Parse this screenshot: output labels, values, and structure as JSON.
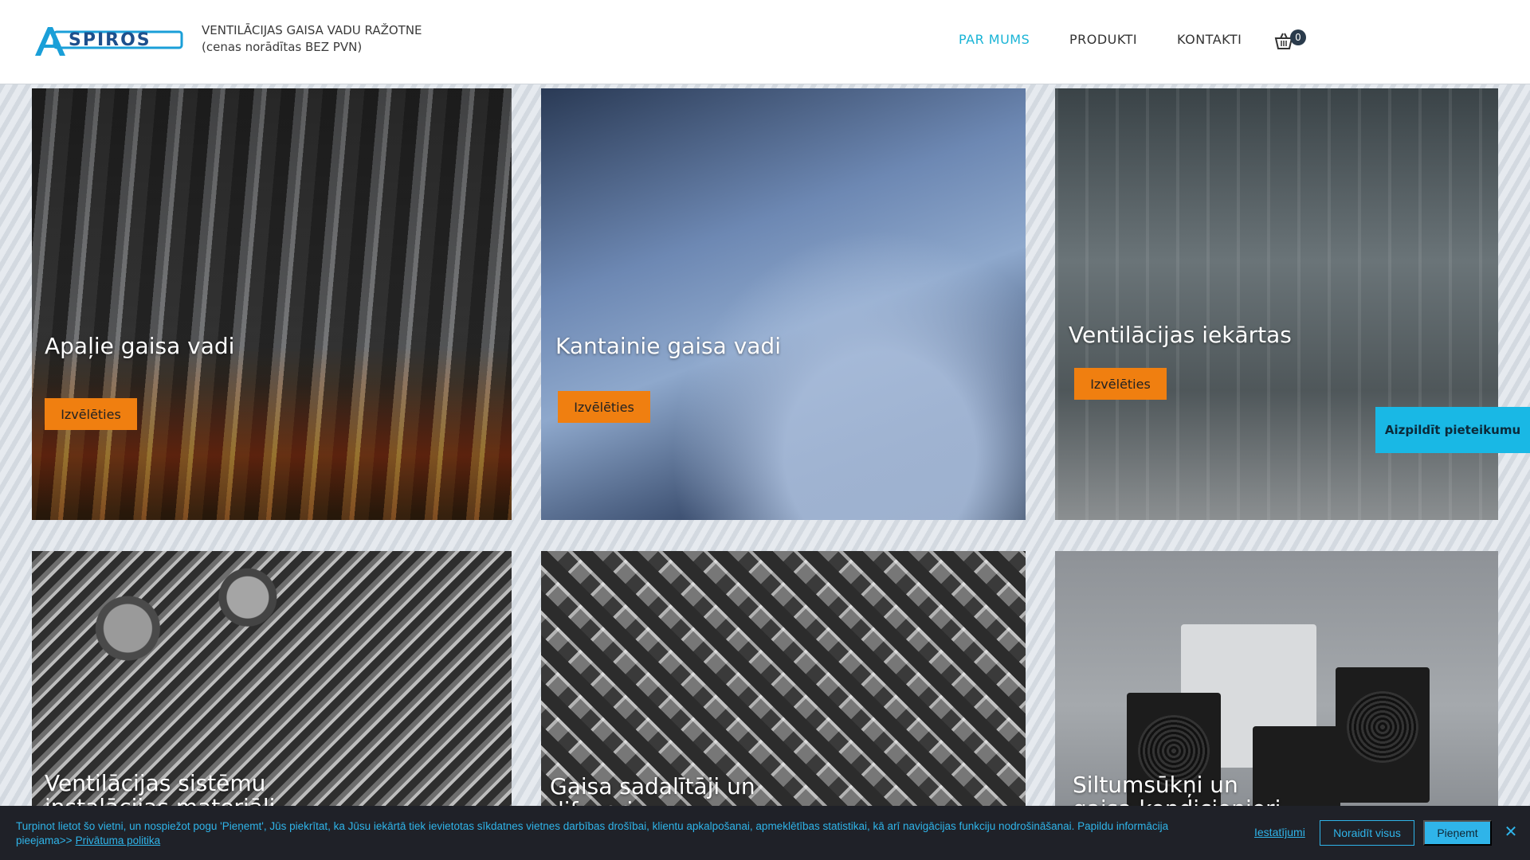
{
  "header": {
    "logo_text": "ASPIROS",
    "tagline_line1": "VENTILĀCIJAS GAISA VADU RAŽOTNE",
    "tagline_line2": "(cenas norādītas BEZ PVN)",
    "nav": {
      "about": "PAR MUMS",
      "products": "PRODUKTI",
      "contacts": "KONTAKTI"
    },
    "cart_count": "0"
  },
  "cards": [
    {
      "title": "Apaļie gaisa vadi",
      "button": "Izvēlēties"
    },
    {
      "title": "Kantainie gaisa vadi",
      "button": "Izvēlēties"
    },
    {
      "title": "Ventilācijas iekārtas",
      "button": "Izvēlēties"
    },
    {
      "title_line1": "Ventilācijas sistēmu",
      "title_line2": "instalācijas materiāli"
    },
    {
      "title_line1": "Gaisa sadalītāji un",
      "title_line2": "difuzori"
    },
    {
      "title_line1": "Siltumsūkņi un",
      "title_line2": "gaisa kondicionieri"
    }
  ],
  "apply_button": "Aizpildīt pieteikumu",
  "cookie": {
    "text": "Turpinot lietot šo vietni, un nospiežot pogu 'Pieņemt', Jūs piekrītat, ka Jūsu iekārtā tiek ievietotas sīkdatnes vietnes darbības drošībai, klientu apkalpošanai, apmeklētības statistikai, kā arī navigācijas funkciju nodrošināšanai. Papildu informācija pieejama>>",
    "privacy_link": "Privātuma politika",
    "settings": "Iestatījumi",
    "reject": "Noraidīt visus",
    "accept": "Pieņemt"
  },
  "colors": {
    "accent": "#19b4d6",
    "button_orange": "#f07f10",
    "cookie_bg": "#1f2128"
  },
  "icons": [
    "cart-icon",
    "close-icon"
  ]
}
